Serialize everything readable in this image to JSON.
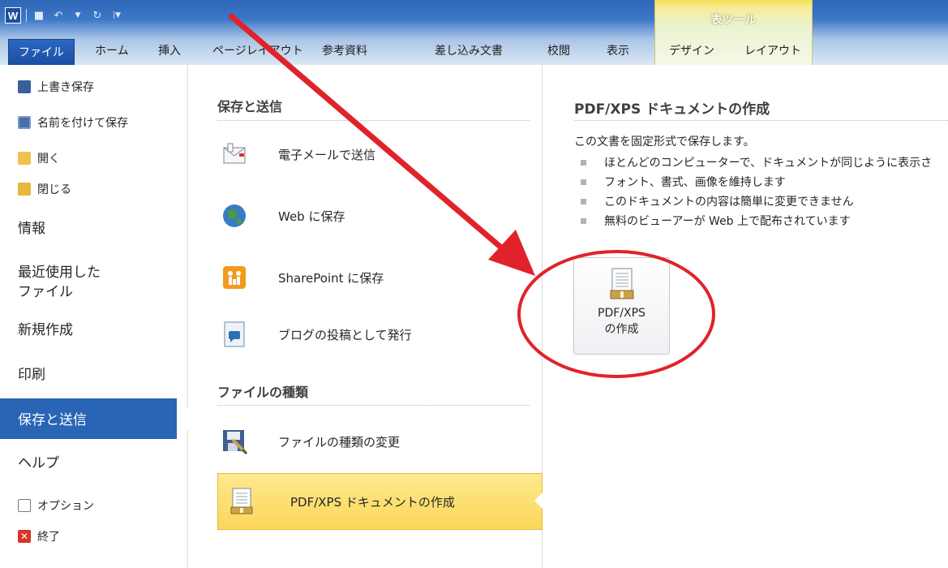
{
  "titlebar": {
    "app_letter": "W",
    "context_tool_title": "表ツール"
  },
  "tabs": {
    "file": "ファイル",
    "home": "ホーム",
    "insert": "挿入",
    "page_layout": "ページレイアウト",
    "references": "参考資料",
    "mailings": "差し込み文書",
    "review": "校閲",
    "view": "表示",
    "design": "デザイン",
    "layout": "レイアウト"
  },
  "nav": {
    "save": "上書き保存",
    "save_as": "名前を付けて保存",
    "open": "開く",
    "close": "閉じる",
    "info": "情報",
    "recent": "最近使用した\nファイル",
    "new": "新規作成",
    "print": "印刷",
    "save_send": "保存と送信",
    "help": "ヘルプ",
    "options": "オプション",
    "exit": "終了"
  },
  "middle": {
    "section1_title": "保存と送信",
    "email": "電子メールで送信",
    "web": "Web に保存",
    "sharepoint": "SharePoint に保存",
    "blog": "ブログの投稿として発行",
    "section2_title": "ファイルの種類",
    "change_type": "ファイルの種類の変更",
    "pdf_xps": "PDF/XPS ドキュメントの作成"
  },
  "right": {
    "title": "PDF/XPS ドキュメントの作成",
    "description": "この文書を固定形式で保存します。",
    "bullets": [
      "ほとんどのコンピューターで、ドキュメントが同じように表示さ",
      "フォント、書式、画像を維持します",
      "このドキュメントの内容は簡単に変更できません",
      "無料のビューアーが Web 上で配布されています"
    ],
    "button_line1": "PDF/XPS",
    "button_line2": "の作成"
  },
  "colors": {
    "file_tab": "#1b4ea3",
    "nav_active": "#2a64b5",
    "selected_item": "#fbd65a",
    "annotation": "#e0232a"
  },
  "icons": {
    "save": "floppy-icon",
    "save_as": "save-as-icon",
    "open": "folder-open-icon",
    "close": "folder-close-icon",
    "options": "options-icon",
    "exit": "exit-icon",
    "email": "mail-icon",
    "web": "globe-icon",
    "sharepoint": "sharepoint-icon",
    "blog": "blog-icon",
    "change_type": "file-type-icon",
    "pdf_xps": "pdf-document-icon"
  }
}
